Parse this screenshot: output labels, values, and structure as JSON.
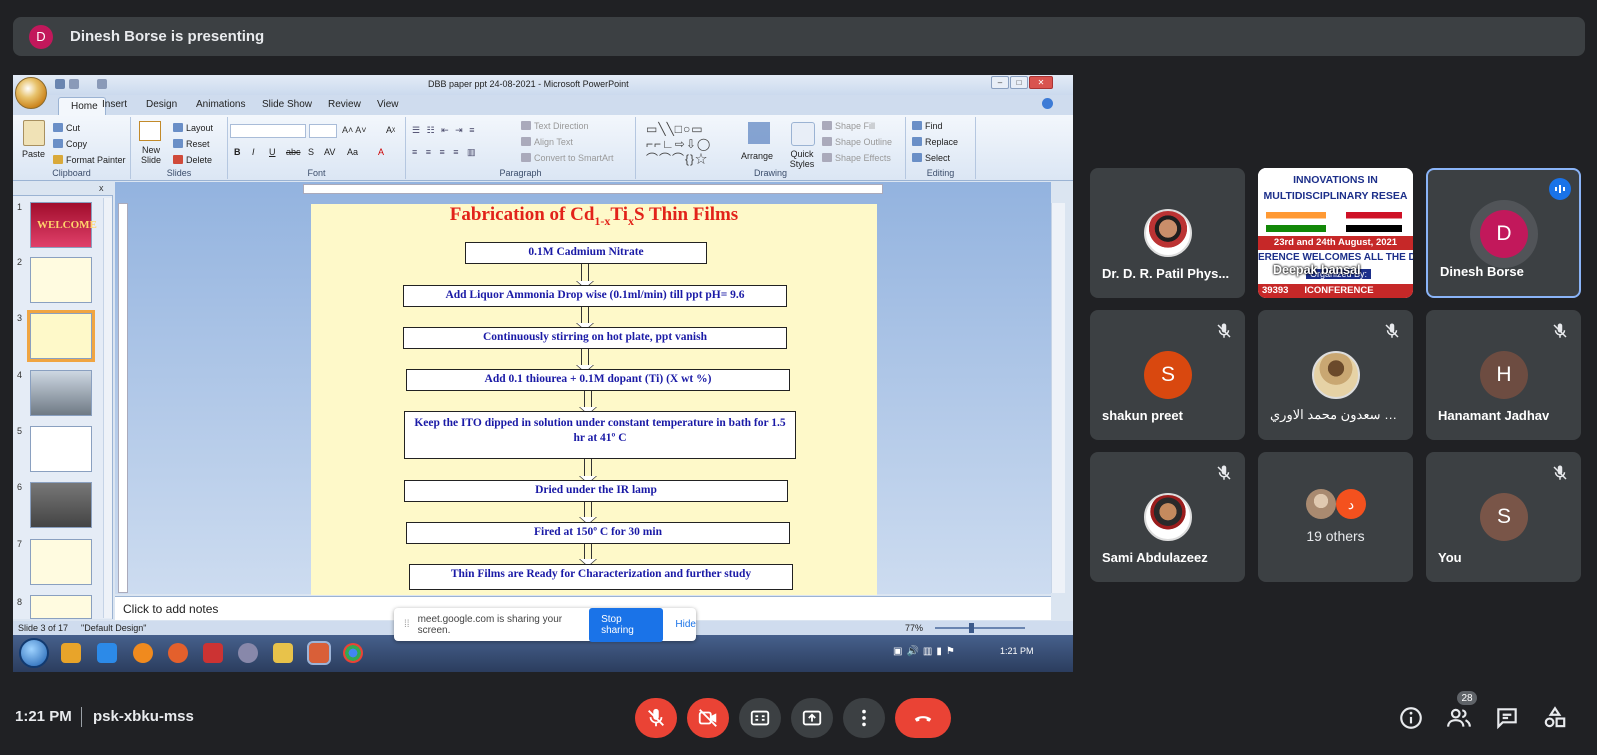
{
  "presenting": {
    "avatar_letter": "D",
    "text": "Dinesh Borse is presenting"
  },
  "powerpoint": {
    "window_title": "DBB  paper ppt       24-08-2021 - Microsoft PowerPoint",
    "tabs": [
      "Home",
      "Insert",
      "Design",
      "Animations",
      "Slide Show",
      "Review",
      "View"
    ],
    "ribbon": {
      "clipboard": {
        "paste": "Paste",
        "cut": "Cut",
        "copy": "Copy",
        "format_painter": "Format Painter",
        "label": "Clipboard"
      },
      "slides": {
        "new_slide": "New Slide",
        "layout": "Layout",
        "reset": "Reset",
        "delete": "Delete",
        "label": "Slides"
      },
      "font": {
        "label": "Font"
      },
      "paragraph": {
        "text_direction": "Text Direction",
        "align_text": "Align Text",
        "convert_smartart": "Convert to SmartArt",
        "label": "Paragraph"
      },
      "drawing": {
        "arrange": "Arrange",
        "quick_styles": "Quick Styles",
        "shape_fill": "Shape Fill",
        "shape_outline": "Shape Outline",
        "shape_effects": "Shape Effects",
        "label": "Drawing"
      },
      "editing": {
        "find": "Find",
        "replace": "Replace",
        "select": "Select",
        "label": "Editing"
      }
    },
    "thumb_numbers": [
      "1",
      "2",
      "3",
      "4",
      "5",
      "6",
      "7",
      "8"
    ],
    "thumb_welcome": "WELCOME",
    "slide": {
      "title_main": "Fabrication of Cd",
      "title_sub1": "1-x",
      "title_mid": "Ti",
      "title_sub2": "x",
      "title_end": "S Thin Films",
      "steps": [
        "0.1M Cadmium  Nitrate",
        "Add Liquor Ammonia  Drop wise  (0.1ml/min)  till  ppt pH= 9.6",
        "Continuously  stirring  on hot plate,  ppt vanish",
        "Add 0.1  thiourea  + 0.1M  dopant  (Ti)  (X wt %)",
        "Keep the ITO dipped in solution  under constant  temperature  in bath for 1.5 hr at 41º C",
        "Dried under the IR lamp",
        "Fired at 150º C for 30 min",
        "Thin Films are Ready for Characterization  and further study"
      ]
    },
    "notes_placeholder": "Click to add notes",
    "status": {
      "slide_info": "Slide 3 of 17",
      "theme": "\"Default Design\"",
      "zoom": "77%"
    },
    "taskbar_clock": "1:21 PM"
  },
  "share_popup": {
    "text": "meet.google.com is sharing your screen.",
    "stop": "Stop sharing",
    "hide": "Hide"
  },
  "participants": [
    {
      "name": "Dr. D. R. Patil Phys..."
    },
    {
      "name": "Deepak bansal",
      "banner_top": "INNOVATIONS IN",
      "banner_top2": "MULTIDISCIPLINARY RESEA",
      "banner_date": "23rd and 24th August, 2021",
      "banner_welcome": "ERENCE WELCOMES ALL THE DELI",
      "banner_org": "Organized By:",
      "banner_conf": "ICONFERENCE",
      "banner_num": "39393"
    },
    {
      "name": "Dinesh Borse",
      "letter": "D"
    },
    {
      "name": "shakun preet",
      "letter": "S"
    },
    {
      "name": "بشرى سعدون محمد الاوري"
    },
    {
      "name": "Hanamant Jadhav",
      "letter": "H"
    },
    {
      "name": "Sami Abdulazeez"
    },
    {
      "name": "19 others",
      "mini_letter": "د"
    },
    {
      "name": "You",
      "letter": "S"
    }
  ],
  "bottom": {
    "time": "1:21 PM",
    "meeting_code": "psk-xbku-mss",
    "people_count": "28"
  },
  "colors": {
    "end_call": "#ea4335",
    "accent": "#1a73e8",
    "tile_bg": "#3c4043"
  }
}
